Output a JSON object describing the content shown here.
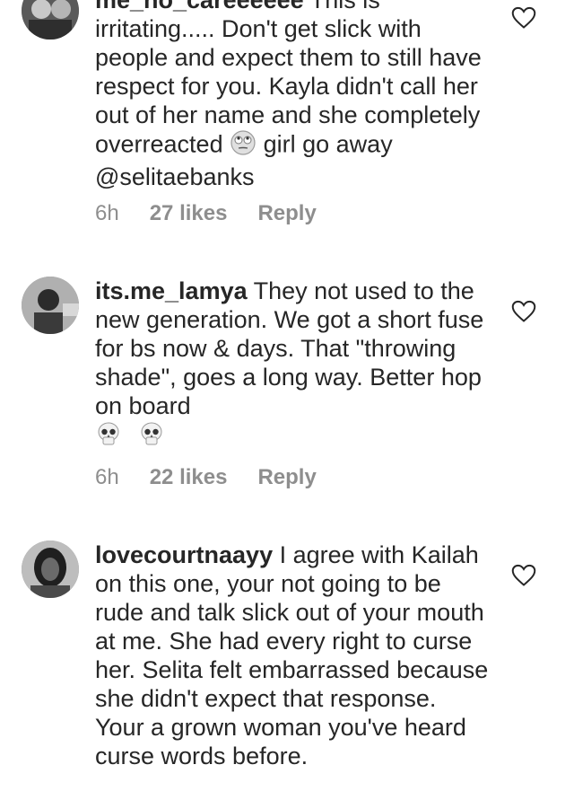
{
  "comments": [
    {
      "username": "me_no_careeeeee",
      "text": "This is irritating..... Don't get slick with people and expect them to still have respect for you. Kayla didn't call her out of her name and she completely overreacted",
      "emoji": "face-with-rolling-eyes",
      "text_after_emoji": "girl go away @selitaebanks",
      "time": "6h",
      "likes": "27 likes",
      "reply": "Reply"
    },
    {
      "username": "its.me_lamya",
      "text": "They not used to the new generation. We got a short fuse for bs now & days. That \"throwing shade\", goes a long way. Better hop on board",
      "emoji": "skull",
      "time": "6h",
      "likes": "22 likes",
      "reply": "Reply"
    },
    {
      "username": "lovecourtnaayy",
      "text": "I agree with Kailah on this one, your not going to be rude and talk slick out of your mouth at me. She had every right to curse her. Selita felt embarrassed because she didn't expect that response. Your a grown woman you've heard curse words before."
    }
  ],
  "colors": {
    "text": "#262626",
    "meta": "#8e8e8e",
    "background": "#ffffff"
  }
}
